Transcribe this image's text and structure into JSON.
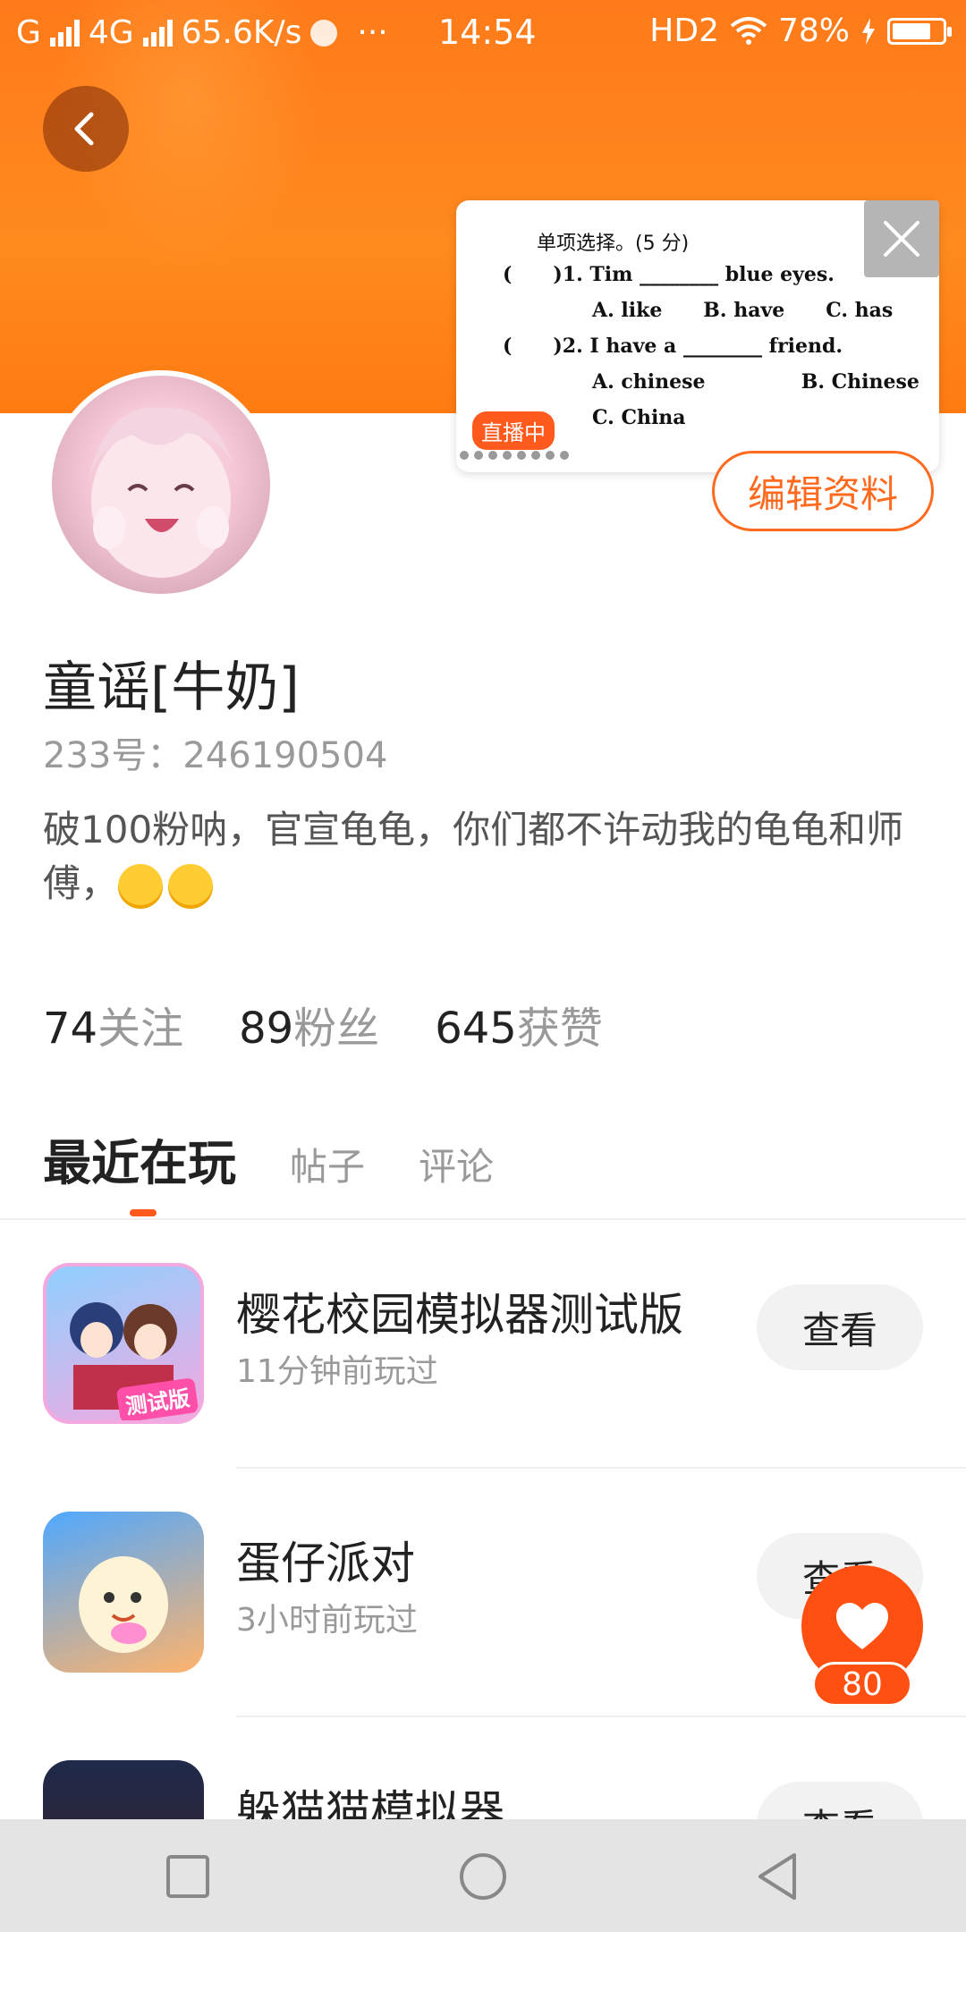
{
  "status_bar": {
    "carrier1": "G",
    "carrier2": "4G",
    "speed": "65.6K/s",
    "more": "···",
    "time": "14:54",
    "hd": "HD2",
    "battery_text": "78%",
    "battery_level": 0.78
  },
  "live_popup": {
    "question_title": "单项选择。(5 分)",
    "lines": [
      "(      )1. Tim ________ blue eyes.",
      "A. like      B. have      C. has",
      "(      )2. I have a ________ friend.",
      "A. chinese              B. Chinese",
      "C. China"
    ],
    "badge": "直播中"
  },
  "profile": {
    "edit_label": "编辑资料",
    "name": "童谣[牛奶]",
    "uid": "233号：246190504",
    "bio_text": "破100粉呐，官宣龟龟，你们都不许动我的龟龟和师傅，",
    "stats": [
      {
        "num": "74",
        "label": "关注"
      },
      {
        "num": "89",
        "label": "粉丝"
      },
      {
        "num": "645",
        "label": "获赞"
      }
    ]
  },
  "tabs": [
    {
      "label": "最近在玩"
    },
    {
      "label": "帖子"
    },
    {
      "label": "评论"
    }
  ],
  "games": [
    {
      "title": "樱花校园模拟器测试版",
      "time": "11分钟前玩过",
      "button": "查看",
      "icon_badge": "测试版"
    },
    {
      "title": "蛋仔派对",
      "time": "3小时前玩过",
      "button": "查看"
    },
    {
      "title": "躲猫猫模拟器",
      "time": "",
      "button": "查看"
    }
  ],
  "like": {
    "count": "80"
  },
  "colors": {
    "accent": "#ff5a1e",
    "header": "#ff7a1a"
  }
}
